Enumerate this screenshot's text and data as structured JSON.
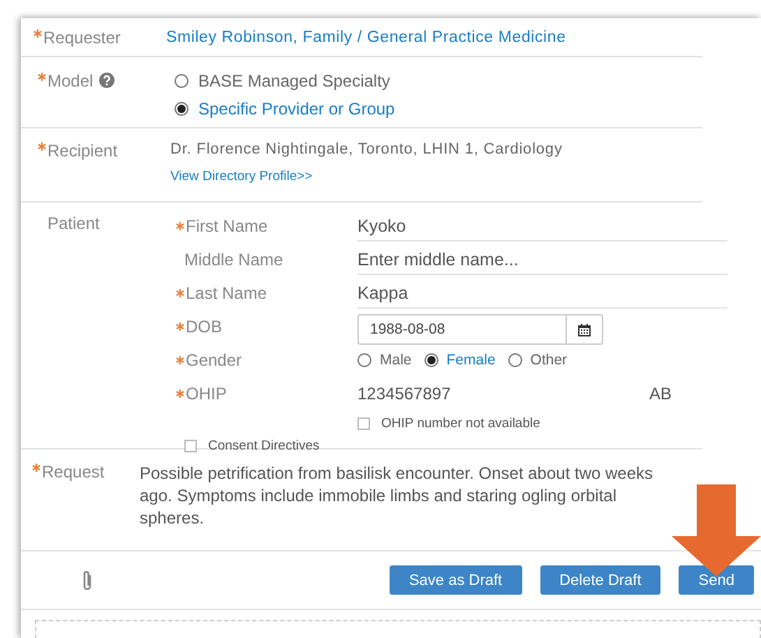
{
  "requester": {
    "label": "Requester",
    "required": true,
    "value": "Smiley Robinson, Family / General Practice Medicine"
  },
  "model": {
    "label": "Model",
    "required": true,
    "options": [
      {
        "label": "BASE Managed Specialty",
        "selected": false
      },
      {
        "label": "Specific Provider or Group",
        "selected": true
      }
    ]
  },
  "recipient": {
    "label": "Recipient",
    "required": true,
    "value": "Dr. Florence Nightingale, Toronto, LHIN 1, Cardiology",
    "link": "View Directory Profile>>"
  },
  "patient": {
    "label": "Patient",
    "fields": [
      {
        "kind": "text",
        "label": "First Name",
        "required": true,
        "value": "Kyoko"
      },
      {
        "kind": "text",
        "label": "Middle Name",
        "required": false,
        "placeholder": "Enter middle name..."
      },
      {
        "kind": "text",
        "label": "Last Name",
        "required": true,
        "value": "Kappa"
      },
      {
        "kind": "date",
        "label": "DOB",
        "required": true,
        "value": "1988-08-08"
      },
      {
        "kind": "radio",
        "label": "Gender",
        "required": true,
        "options": [
          {
            "label": "Male",
            "selected": false
          },
          {
            "label": "Female",
            "selected": true
          },
          {
            "label": "Other",
            "selected": false
          }
        ]
      },
      {
        "kind": "ohip",
        "label": "OHIP",
        "required": true,
        "value": "1234567897",
        "province": "AB",
        "unavailable": {
          "label": "OHIP number not available",
          "checked": false
        }
      }
    ],
    "consent": {
      "label": "Consent Directives",
      "checked": false
    }
  },
  "request": {
    "label": "Request",
    "required": true,
    "value": "Possible petrification from basilisk encounter. Onset about two weeks ago. Symptoms include immobile limbs and staring ogling orbital spheres."
  },
  "footer": {
    "buttons": [
      "Save as Draft",
      "Delete Draft",
      "Send"
    ]
  }
}
